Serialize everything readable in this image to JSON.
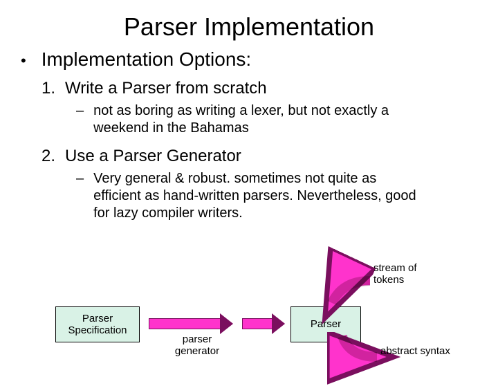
{
  "title": "Parser Implementation",
  "bullet": {
    "marker": "•",
    "text": "Implementation Options:"
  },
  "items": [
    {
      "num": "1.",
      "text": "Write a Parser from scratch",
      "dash": {
        "marker": "–",
        "text": "not as boring as writing a lexer, but not exactly a weekend in the Bahamas"
      }
    },
    {
      "num": "2.",
      "text": "Use a Parser Generator",
      "dash": {
        "marker": "–",
        "text": "Very general & robust.  sometimes not quite as efficient as hand-written parsers.  Nevertheless, good for lazy compiler writers."
      }
    }
  ],
  "diagram": {
    "box_spec": "Parser Specification",
    "box_parser": "Parser",
    "label_pg": "parser generator",
    "label_stream": "stream of tokens",
    "label_ast": "abstract syntax"
  }
}
